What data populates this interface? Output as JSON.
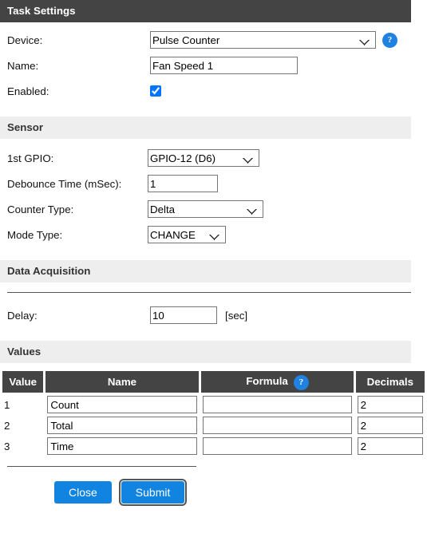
{
  "sections": {
    "task_settings": {
      "title": "Task Settings",
      "device": {
        "label": "Device:",
        "value": "Pulse Counter"
      },
      "name": {
        "label": "Name:",
        "value": "Fan Speed 1"
      },
      "enabled": {
        "label": "Enabled:",
        "checked": true
      }
    },
    "sensor": {
      "title": "Sensor",
      "gpio": {
        "label": "1st GPIO:",
        "value": "GPIO-12 (D6)"
      },
      "debounce": {
        "label": "Debounce Time (mSec):",
        "value": "1"
      },
      "counter_type": {
        "label": "Counter Type:",
        "value": "Delta"
      },
      "mode_type": {
        "label": "Mode Type:",
        "value": "CHANGE"
      }
    },
    "data_acquisition": {
      "title": "Data Acquisition",
      "delay": {
        "label": "Delay:",
        "value": "10",
        "unit": "[sec]"
      }
    },
    "values": {
      "title": "Values",
      "columns": {
        "value": "Value",
        "name": "Name",
        "formula": "Formula",
        "decimals": "Decimals"
      },
      "rows": [
        {
          "index": "1",
          "name": "Count",
          "formula": "",
          "decimals": "2"
        },
        {
          "index": "2",
          "name": "Total",
          "formula": "",
          "decimals": "2"
        },
        {
          "index": "3",
          "name": "Time",
          "formula": "",
          "decimals": "2"
        }
      ]
    }
  },
  "icons": {
    "help_glyph": "?"
  },
  "buttons": {
    "close": "Close",
    "submit": "Submit"
  },
  "colors": {
    "header_dark": "#444444",
    "header_light": "#eeeeee",
    "accent_blue": "#1183e0",
    "help_blue": "#1f82e0"
  }
}
